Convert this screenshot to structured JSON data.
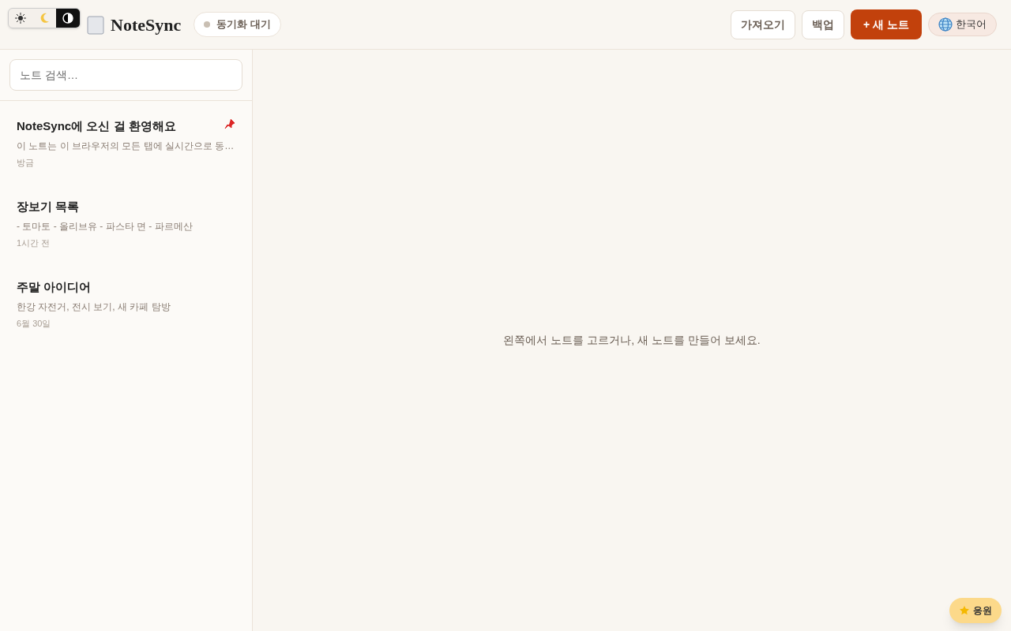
{
  "theme_switcher": [
    {
      "kind": "light",
      "selected": false
    },
    {
      "kind": "dark",
      "selected": false
    },
    {
      "kind": "contrast",
      "selected": true
    }
  ],
  "header": {
    "logo": "NoteSync",
    "sync_status": "동기화 대기",
    "buttons": [
      {
        "label": "가져오기",
        "kind": "secondary"
      },
      {
        "label": "백업",
        "kind": "secondary"
      },
      {
        "label": "+ 새 노트",
        "kind": "primary"
      }
    ],
    "language": "한국어"
  },
  "search": {
    "placeholder": "노트 검색…"
  },
  "notes": [
    {
      "title": "NoteSync에 오신 걸 환영해요",
      "preview": "이 노트는 이 브라우저의 모든 탭에 실시간으로 동…",
      "time": "방금",
      "pinned": true
    },
    {
      "title": "장보기 목록",
      "preview": "- 토마토 - 올리브유 - 파스타 면 - 파르메산",
      "time": "1시간 전",
      "pinned": false
    },
    {
      "title": "주말 아이디어",
      "preview": "한강 자전거, 전시 보기, 새 카페 탐방",
      "time": "6월 30일",
      "pinned": false
    }
  ],
  "empty_message": "왼쪽에서 노트를 고르거나, 새 노트를 만들어 보세요.",
  "support_button": "응원"
}
